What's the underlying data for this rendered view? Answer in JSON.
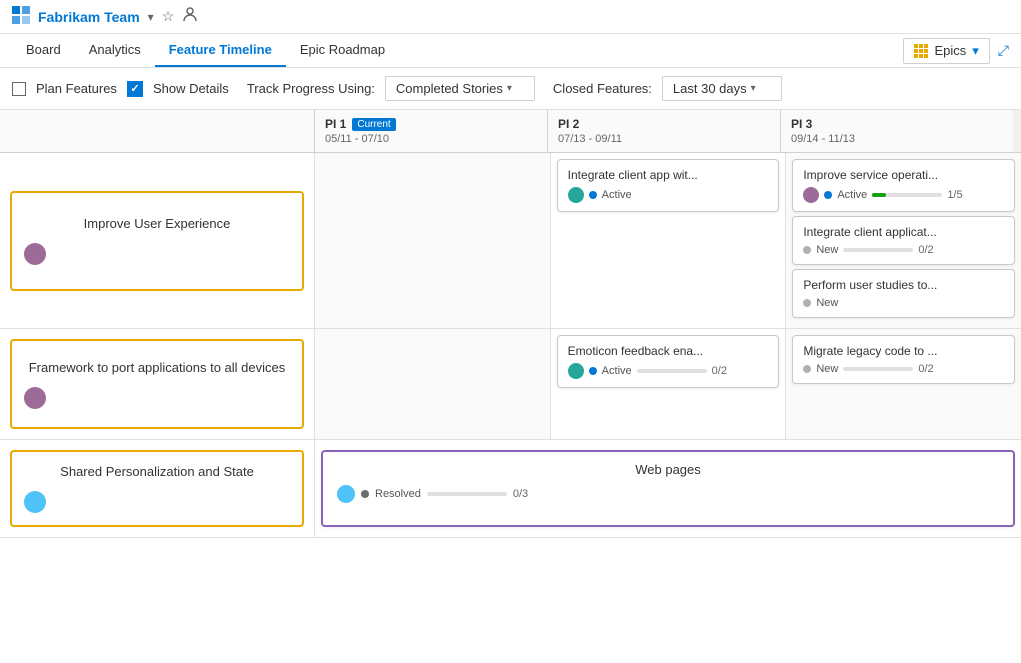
{
  "topbar": {
    "team_name": "Fabrikam Team",
    "star_icon": "★",
    "user_icon": "👤"
  },
  "nav": {
    "tabs": [
      {
        "id": "board",
        "label": "Board",
        "active": false
      },
      {
        "id": "analytics",
        "label": "Analytics",
        "active": false
      },
      {
        "id": "feature-timeline",
        "label": "Feature Timeline",
        "active": true
      },
      {
        "id": "epic-roadmap",
        "label": "Epic Roadmap",
        "active": false
      }
    ]
  },
  "toolbar": {
    "plan_features_label": "Plan Features",
    "show_details_label": "Show Details",
    "track_label": "Track Progress Using:",
    "progress_option": "Completed Stories",
    "closed_label": "Closed Features:",
    "closed_option": "Last 30 days",
    "epics_label": "Epics"
  },
  "pi_headers": [
    {
      "id": "pi1",
      "label": "PI 1",
      "badge": "Current",
      "dates": "05/11 - 07/10"
    },
    {
      "id": "pi2",
      "label": "PI 2",
      "dates": "07/13 - 09/11"
    },
    {
      "id": "pi3",
      "label": "PI 3",
      "dates": "09/14 - 11/13"
    }
  ],
  "rows": [
    {
      "epic_title": "Improve User Experience",
      "cells": [
        {
          "pi": 1,
          "cards": []
        },
        {
          "pi": 2,
          "cards": [
            {
              "title": "Integrate client app wit...",
              "status": "Active",
              "status_type": "active",
              "has_avatar": true,
              "avatar_color": "teal",
              "show_progress": false,
              "progress": 0,
              "total": 0
            }
          ]
        },
        {
          "pi": 3,
          "cards": [
            {
              "title": "Improve service operati...",
              "status": "Active",
              "status_type": "active",
              "has_avatar": true,
              "avatar_color": "purple",
              "show_progress": true,
              "progress": 20,
              "count": "1/5"
            },
            {
              "title": "Integrate client applicat...",
              "status": "New",
              "status_type": "new",
              "has_avatar": false,
              "show_progress": true,
              "progress": 0,
              "count": "0/2"
            },
            {
              "title": "Perform user studies to...",
              "status": "New",
              "status_type": "new",
              "has_avatar": false,
              "show_progress": false,
              "progress": 0,
              "count": ""
            }
          ]
        }
      ]
    },
    {
      "epic_title": "Framework to port applications to all devices",
      "cells": [
        {
          "pi": 1,
          "cards": []
        },
        {
          "pi": 2,
          "cards": [
            {
              "title": "Emoticon feedback ena...",
              "status": "Active",
              "status_type": "active",
              "has_avatar": true,
              "avatar_color": "teal",
              "show_progress": true,
              "progress": 0,
              "count": "0/2"
            }
          ]
        },
        {
          "pi": 3,
          "cards": [
            {
              "title": "Migrate legacy code to ...",
              "status": "New",
              "status_type": "new",
              "has_avatar": false,
              "show_progress": true,
              "progress": 0,
              "count": "0/2"
            }
          ]
        }
      ]
    },
    {
      "epic_title": "Shared Personalization and State",
      "cells": [
        {
          "pi": 1,
          "cards": []
        },
        {
          "pi": 2,
          "cards": []
        },
        {
          "pi": 3,
          "cards": []
        }
      ],
      "spanning_card": {
        "title": "Web pages",
        "status": "Resolved",
        "status_type": "resolved",
        "has_avatar": true,
        "avatar_color": "blue",
        "show_progress": true,
        "progress": 0,
        "count": "0/3"
      }
    }
  ]
}
